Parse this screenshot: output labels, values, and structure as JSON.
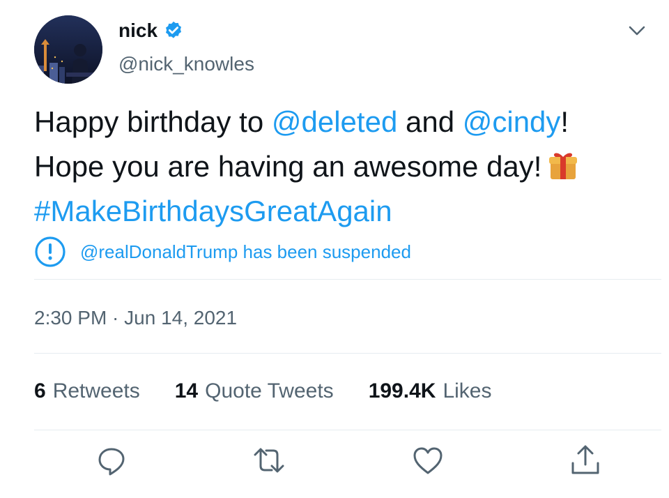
{
  "author": {
    "name": "nick",
    "handle": "@nick_knowles",
    "verified": true
  },
  "tweet": {
    "line1": {
      "prefix": "Happy birthday to ",
      "mention1": "@deleted",
      "middle": " and ",
      "mention2": "@cindy",
      "suffix": "!"
    },
    "line2": "Hope you are having an awesome day!",
    "hashtag": "#MakeBirthdaysGreatAgain",
    "emoji": "gift-icon"
  },
  "notice": {
    "text": "@realDonaldTrump has been suspended",
    "icon": "alert-circle-icon"
  },
  "timestamp": "2:30 PM · Jun 14, 2021",
  "stats": {
    "retweets": {
      "count": "6",
      "label": "Retweets"
    },
    "quotes": {
      "count": "14",
      "label": "Quote Tweets"
    },
    "likes": {
      "count": "199.4K",
      "label": "Likes"
    }
  },
  "actions": [
    "reply-icon",
    "retweet-icon",
    "like-icon",
    "share-icon"
  ],
  "colors": {
    "accent": "#1d9bf0",
    "text": "#0f1419",
    "muted": "#536471",
    "divider": "#e6ecf0"
  }
}
